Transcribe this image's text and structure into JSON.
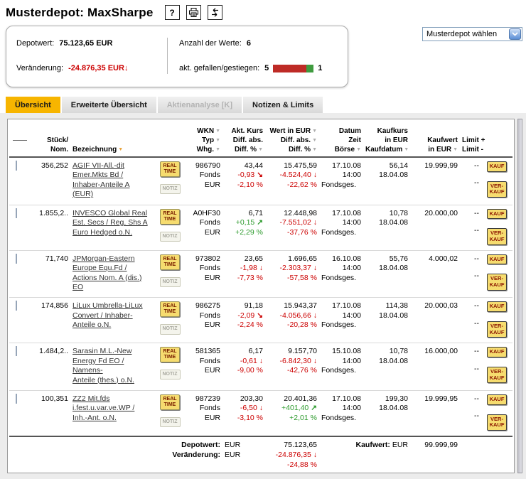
{
  "header": {
    "title": "Musterdepot: MaxSharpe",
    "help_glyph": "?"
  },
  "icons": {
    "sort_arrow": "▼"
  },
  "summary": {
    "depotwert_label": "Depotwert:",
    "depotwert_value": "75.123,65 EUR",
    "veraenderung_label": "Veränderung:",
    "veraenderung_value": "-24.876,35 EUR",
    "veraenderung_arrow": "↓",
    "anzahl_label": "Anzahl der Werte:",
    "anzahl_value": "6",
    "gefallen_label": "akt. gefallen/gestiegen:",
    "gefallen_count": "5",
    "gestiegen_count": "1"
  },
  "depot_select": {
    "value": "Musterdepot wählen"
  },
  "tabs": [
    {
      "label": "Übersicht",
      "state": "active"
    },
    {
      "label": "Erweiterte Übersicht",
      "state": "normal"
    },
    {
      "label": "Aktienanalyse [K]",
      "state": "disabled"
    },
    {
      "label": "Notizen & Limits",
      "state": "normal"
    }
  ],
  "colors": {
    "accent_yellow": "#F7B500",
    "negative_red": "#CC0000",
    "positive_green": "#2E9B2E",
    "button_yellow": "#F6DC6F",
    "bar_red": "#BE2B26",
    "bar_green": "#3F9B3F"
  },
  "table": {
    "headers": {
      "stueck_l1": "Stück/",
      "stueck_l2": "Nom.",
      "bezeichnung": "Bezeichnung",
      "wkn_l1": "WKN",
      "wkn_l2": "Typ",
      "wkn_l3": "Whg.",
      "kurs_l1": "Akt. Kurs",
      "kurs_l2": "Diff. abs.",
      "kurs_l3": "Diff. %",
      "wert_l1": "Wert in EUR",
      "wert_l2": "Diff. abs.",
      "wert_l3": "Diff. %",
      "datum_l1": "Datum",
      "datum_l2": "Zeit",
      "datum_l3": "Börse",
      "kaufkurs_l1": "Kaufkurs",
      "kaufkurs_l2": "in EUR",
      "kaufkurs_l3": "Kaufdatum",
      "kaufwert_l1": "Kaufwert",
      "kaufwert_l2": "in EUR",
      "limit_l1": "Limit +",
      "limit_l2": "Limit -"
    },
    "buttons": {
      "realtime_l1": "REAL",
      "realtime_l2": "TIME",
      "notiz": "NOTIZ",
      "kauf": "KAUF",
      "verkauf_l1": "VER-",
      "verkauf_l2": "KAUF"
    },
    "rows": [
      {
        "qty": "356,252",
        "name": "AGIF VII-All.-dit\nEmer.Mkts Bd /\nInhaber-Anteile A\n(EUR)",
        "wkn": "986790",
        "typ": "Fonds",
        "whg": "EUR",
        "kurs": "43,44",
        "kurs_diff_abs": "-0,93",
        "kurs_arrow": "↘",
        "kurs_diff_pct": "-2,10 %",
        "kurs_trend": "down",
        "wert": "15.475,59",
        "wert_diff_abs": "-4.524,40",
        "wert_arrow": "↓",
        "wert_diff_pct": "-22,62 %",
        "wert_trend": "down",
        "datum": "17.10.08",
        "zeit": "14:00",
        "boerse": "Fondsges.",
        "kaufkurs": "56,14",
        "kaufdatum": "18.04.08",
        "kaufwert": "19.999,99",
        "limit_plus": "--",
        "limit_minus": "--"
      },
      {
        "qty": "1.855,2..",
        "name": "INVESCO Global Real\nEst. Secs / Reg. Shs A\nEuro Hedged o.N.",
        "wkn": "A0HF30",
        "typ": "Fonds",
        "whg": "EUR",
        "kurs": "6,71",
        "kurs_diff_abs": "+0,15",
        "kurs_arrow": "↗",
        "kurs_diff_pct": "+2,29 %",
        "kurs_trend": "up",
        "wert": "12.448,98",
        "wert_diff_abs": "-7.551,02",
        "wert_arrow": "↓",
        "wert_diff_pct": "-37,76 %",
        "wert_trend": "down",
        "datum": "17.10.08",
        "zeit": "14:00",
        "boerse": "Fondsges.",
        "kaufkurs": "10,78",
        "kaufdatum": "18.04.08",
        "kaufwert": "20.000,00",
        "limit_plus": "--",
        "limit_minus": "--"
      },
      {
        "qty": "71,740",
        "name": "JPMorgan-Eastern\nEurope Equ.Fd /\nActions Nom. A (dis.)\nEO",
        "wkn": "973802",
        "typ": "Fonds",
        "whg": "EUR",
        "kurs": "23,65",
        "kurs_diff_abs": "-1,98",
        "kurs_arrow": "↓",
        "kurs_diff_pct": "-7,73 %",
        "kurs_trend": "down",
        "wert": "1.696,65",
        "wert_diff_abs": "-2.303,37",
        "wert_arrow": "↓",
        "wert_diff_pct": "-57,58 %",
        "wert_trend": "down",
        "datum": "16.10.08",
        "zeit": "14:00",
        "boerse": "Fondsges.",
        "kaufkurs": "55,76",
        "kaufdatum": "18.04.08",
        "kaufwert": "4.000,02",
        "limit_plus": "--",
        "limit_minus": "--"
      },
      {
        "qty": "174,856",
        "name": "LiLux Umbrella-LiLux\nConvert / Inhaber-\nAnteile o.N.",
        "wkn": "986275",
        "typ": "Fonds",
        "whg": "EUR",
        "kurs": "91,18",
        "kurs_diff_abs": "-2,09",
        "kurs_arrow": "↘",
        "kurs_diff_pct": "-2,24 %",
        "kurs_trend": "down",
        "wert": "15.943,37",
        "wert_diff_abs": "-4.056,66",
        "wert_arrow": "↓",
        "wert_diff_pct": "-20,28 %",
        "wert_trend": "down",
        "datum": "17.10.08",
        "zeit": "14:00",
        "boerse": "Fondsges.",
        "kaufkurs": "114,38",
        "kaufdatum": "18.04.08",
        "kaufwert": "20.000,03",
        "limit_plus": "--",
        "limit_minus": "--"
      },
      {
        "qty": "1.484,2..",
        "name": "Sarasin M.L.-New\nEnergy Fd EO /\nNamens-\nAnteile (thes.) o.N.",
        "wkn": "581365",
        "typ": "Fonds",
        "whg": "EUR",
        "kurs": "6,17",
        "kurs_diff_abs": "-0,61",
        "kurs_arrow": "↓",
        "kurs_diff_pct": "-9,00 %",
        "kurs_trend": "down",
        "wert": "9.157,70",
        "wert_diff_abs": "-6.842,30",
        "wert_arrow": "↓",
        "wert_diff_pct": "-42,76 %",
        "wert_trend": "down",
        "datum": "15.10.08",
        "zeit": "14:00",
        "boerse": "Fondsges.",
        "kaufkurs": "10,78",
        "kaufdatum": "18.04.08",
        "kaufwert": "16.000,00",
        "limit_plus": "--",
        "limit_minus": "--"
      },
      {
        "qty": "100,351",
        "name": "ZZ2 Mit.fds\ni.fest.u.var.ve.WP /\nInh.-Ant. o.N.",
        "wkn": "987239",
        "typ": "Fonds",
        "whg": "EUR",
        "kurs": "203,30",
        "kurs_diff_abs": "-6,50",
        "kurs_arrow": "↓",
        "kurs_diff_pct": "-3,10 %",
        "kurs_trend": "down",
        "wert": "20.401,36",
        "wert_diff_abs": "+401,40",
        "wert_arrow": "↗",
        "wert_diff_pct": "+2,01 %",
        "wert_trend": "up",
        "datum": "17.10.08",
        "zeit": "14:00",
        "boerse": "Fondsges.",
        "kaufkurs": "199,30",
        "kaufdatum": "18.04.08",
        "kaufwert": "19.999,95",
        "limit_plus": "--",
        "limit_minus": "--"
      }
    ],
    "footer": {
      "depotwert_label": "Depotwert:",
      "veraenderung_label": "Veränderung:",
      "eur": "EUR",
      "depotwert_value": "75.123,65",
      "veraenderung_value": "-24.876,35",
      "veraenderung_arrow": "↓",
      "veraenderung_pct": "-24,88 %",
      "kaufwert_label": "Kaufwert:",
      "kaufwert_value": "99.999,99"
    }
  }
}
